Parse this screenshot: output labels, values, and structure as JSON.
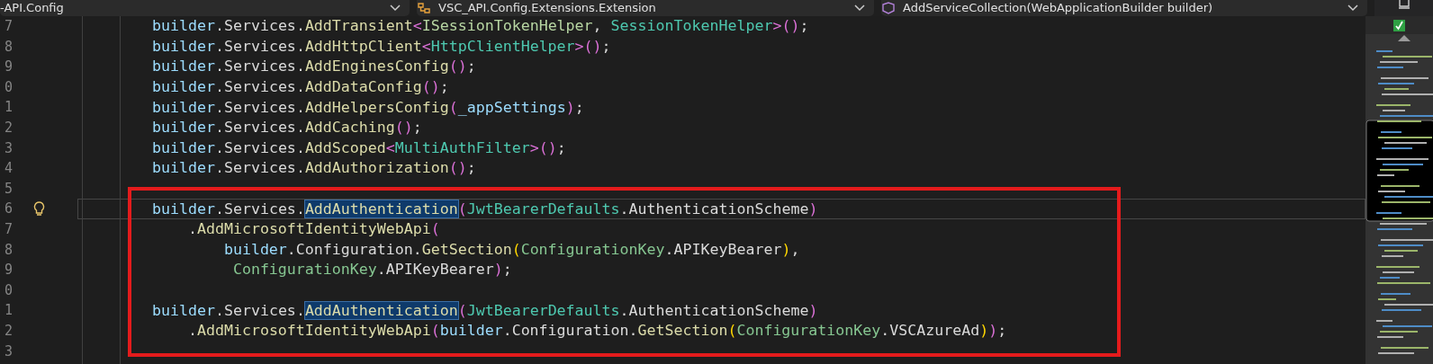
{
  "navigation_bar": [
    {
      "label": "-API.Config",
      "kind": "plain"
    },
    {
      "label": "VSC_API.Config.Extensions.Extension",
      "kind": "class"
    },
    {
      "label": "AddServiceCollection(WebApplicationBuilder builder)",
      "kind": "method"
    }
  ],
  "editor": {
    "lines": [
      {
        "number": "7",
        "current": false,
        "segments": [
          {
            "text": "builder",
            "kind": "local"
          },
          {
            "text": ".",
            "kind": "punct"
          },
          {
            "text": "Services",
            "kind": "member"
          },
          {
            "text": ".",
            "kind": "punct"
          },
          {
            "text": "AddTransient",
            "kind": "method"
          },
          {
            "text": "<",
            "kind": "brace-pink"
          },
          {
            "text": "ISessionTokenHelper",
            "kind": "interface"
          },
          {
            "text": ", ",
            "kind": "punct"
          },
          {
            "text": "SessionTokenHelper",
            "kind": "type"
          },
          {
            "text": ">()",
            "kind": "brace-pink"
          },
          {
            "text": ";",
            "kind": "punct"
          }
        ]
      },
      {
        "number": "8",
        "current": false,
        "segments": [
          {
            "text": "builder",
            "kind": "local"
          },
          {
            "text": ".",
            "kind": "punct"
          },
          {
            "text": "Services",
            "kind": "member"
          },
          {
            "text": ".",
            "kind": "punct"
          },
          {
            "text": "AddHttpClient",
            "kind": "method"
          },
          {
            "text": "<",
            "kind": "brace-pink"
          },
          {
            "text": "HttpClientHelper",
            "kind": "type"
          },
          {
            "text": ">()",
            "kind": "brace-pink"
          },
          {
            "text": ";",
            "kind": "punct"
          }
        ]
      },
      {
        "number": "9",
        "current": false,
        "segments": [
          {
            "text": "builder",
            "kind": "local"
          },
          {
            "text": ".",
            "kind": "punct"
          },
          {
            "text": "Services",
            "kind": "member"
          },
          {
            "text": ".",
            "kind": "punct"
          },
          {
            "text": "AddEnginesConfig",
            "kind": "method"
          },
          {
            "text": "()",
            "kind": "brace-pink"
          },
          {
            "text": ";",
            "kind": "punct"
          }
        ]
      },
      {
        "number": "0",
        "current": false,
        "segments": [
          {
            "text": "builder",
            "kind": "local"
          },
          {
            "text": ".",
            "kind": "punct"
          },
          {
            "text": "Services",
            "kind": "member"
          },
          {
            "text": ".",
            "kind": "punct"
          },
          {
            "text": "AddDataConfig",
            "kind": "method"
          },
          {
            "text": "()",
            "kind": "brace-pink"
          },
          {
            "text": ";",
            "kind": "punct"
          }
        ]
      },
      {
        "number": "1",
        "current": false,
        "segments": [
          {
            "text": "builder",
            "kind": "local"
          },
          {
            "text": ".",
            "kind": "punct"
          },
          {
            "text": "Services",
            "kind": "member"
          },
          {
            "text": ".",
            "kind": "punct"
          },
          {
            "text": "AddHelpersConfig",
            "kind": "method"
          },
          {
            "text": "(",
            "kind": "brace-pink"
          },
          {
            "text": "_appSettings",
            "kind": "local"
          },
          {
            "text": ")",
            "kind": "brace-pink"
          },
          {
            "text": ";",
            "kind": "punct"
          }
        ]
      },
      {
        "number": "2",
        "current": false,
        "segments": [
          {
            "text": "builder",
            "kind": "local"
          },
          {
            "text": ".",
            "kind": "punct"
          },
          {
            "text": "Services",
            "kind": "member"
          },
          {
            "text": ".",
            "kind": "punct"
          },
          {
            "text": "AddCaching",
            "kind": "method"
          },
          {
            "text": "()",
            "kind": "brace-pink"
          },
          {
            "text": ";",
            "kind": "punct"
          }
        ]
      },
      {
        "number": "3",
        "current": false,
        "segments": [
          {
            "text": "builder",
            "kind": "local"
          },
          {
            "text": ".",
            "kind": "punct"
          },
          {
            "text": "Services",
            "kind": "member"
          },
          {
            "text": ".",
            "kind": "punct"
          },
          {
            "text": "AddScoped",
            "kind": "method"
          },
          {
            "text": "<",
            "kind": "brace-pink"
          },
          {
            "text": "MultiAuthFilter",
            "kind": "type"
          },
          {
            "text": ">()",
            "kind": "brace-pink"
          },
          {
            "text": ";",
            "kind": "punct"
          }
        ]
      },
      {
        "number": "4",
        "current": false,
        "segments": [
          {
            "text": "builder",
            "kind": "local"
          },
          {
            "text": ".",
            "kind": "punct"
          },
          {
            "text": "Services",
            "kind": "member"
          },
          {
            "text": ".",
            "kind": "punct"
          },
          {
            "text": "AddAuthorization",
            "kind": "method"
          },
          {
            "text": "()",
            "kind": "brace-pink"
          },
          {
            "text": ";",
            "kind": "punct"
          }
        ]
      },
      {
        "number": "5",
        "current": false
      },
      {
        "number": "6",
        "current": true,
        "segments": [
          {
            "text": "builder",
            "kind": "local"
          },
          {
            "text": ".",
            "kind": "punct"
          },
          {
            "text": "Services",
            "kind": "member"
          },
          {
            "text": ".",
            "kind": "punct"
          },
          {
            "text": "AddAuthentication",
            "kind": "method-match"
          },
          {
            "text": "(",
            "kind": "brace-pink"
          },
          {
            "text": "JwtBearerDefaults",
            "kind": "type"
          },
          {
            "text": ".",
            "kind": "punct"
          },
          {
            "text": "AuthenticationScheme",
            "kind": "member"
          },
          {
            "text": ")",
            "kind": "brace-pink"
          }
        ]
      },
      {
        "number": "7",
        "current": false,
        "segments": [
          {
            "text": "    .",
            "kind": "punct"
          },
          {
            "text": "AddMicrosoftIdentityWebApi",
            "kind": "method"
          },
          {
            "text": "(",
            "kind": "brace-pink"
          }
        ]
      },
      {
        "number": "8",
        "current": false,
        "segments": [
          {
            "text": "        builder",
            "kind": "local"
          },
          {
            "text": ".",
            "kind": "punct"
          },
          {
            "text": "Configuration",
            "kind": "member"
          },
          {
            "text": ".",
            "kind": "punct"
          },
          {
            "text": "GetSection",
            "kind": "method"
          },
          {
            "text": "(",
            "kind": "brace-yellow"
          },
          {
            "text": "ConfigurationKey",
            "kind": "class"
          },
          {
            "text": ".",
            "kind": "punct"
          },
          {
            "text": "APIKeyBearer",
            "kind": "member"
          },
          {
            "text": ")",
            "kind": "brace-yellow"
          },
          {
            "text": ",",
            "kind": "punct"
          }
        ]
      },
      {
        "number": "9",
        "current": false,
        "segments": [
          {
            "text": "         ConfigurationKey",
            "kind": "class"
          },
          {
            "text": ".",
            "kind": "punct"
          },
          {
            "text": "APIKeyBearer",
            "kind": "member"
          },
          {
            "text": ")",
            "kind": "brace-pink"
          },
          {
            "text": ";",
            "kind": "punct"
          }
        ]
      },
      {
        "number": "0",
        "current": false
      },
      {
        "number": "1",
        "current": false,
        "segments": [
          {
            "text": "builder",
            "kind": "local"
          },
          {
            "text": ".",
            "kind": "punct"
          },
          {
            "text": "Services",
            "kind": "member"
          },
          {
            "text": ".",
            "kind": "punct"
          },
          {
            "text": "AddAuthentication",
            "kind": "method-match"
          },
          {
            "text": "(",
            "kind": "brace-pink"
          },
          {
            "text": "JwtBearerDefaults",
            "kind": "type"
          },
          {
            "text": ".",
            "kind": "punct"
          },
          {
            "text": "AuthenticationScheme",
            "kind": "member"
          },
          {
            "text": ")",
            "kind": "brace-pink"
          }
        ]
      },
      {
        "number": "2",
        "current": false,
        "segments": [
          {
            "text": "    .",
            "kind": "punct"
          },
          {
            "text": "AddMicrosoftIdentityWebApi",
            "kind": "method"
          },
          {
            "text": "(",
            "kind": "brace-pink"
          },
          {
            "text": "builder",
            "kind": "local"
          },
          {
            "text": ".",
            "kind": "punct"
          },
          {
            "text": "Configuration",
            "kind": "member"
          },
          {
            "text": ".",
            "kind": "punct"
          },
          {
            "text": "GetSection",
            "kind": "method"
          },
          {
            "text": "(",
            "kind": "brace-yellow"
          },
          {
            "text": "ConfigurationKey",
            "kind": "class"
          },
          {
            "text": ".",
            "kind": "punct"
          },
          {
            "text": "VSCAzureAd",
            "kind": "member"
          },
          {
            "text": ")",
            "kind": "brace-yellow"
          },
          {
            "text": ")",
            "kind": "brace-pink"
          },
          {
            "text": ";",
            "kind": "punct"
          }
        ]
      },
      {
        "number": "3",
        "current": false
      }
    ]
  }
}
